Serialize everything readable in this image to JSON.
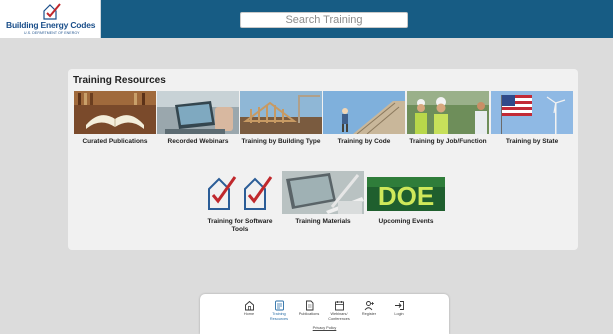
{
  "header": {
    "logo_title": "Building Energy Codes",
    "logo_subtitle": "U.S. DEPARTMENT OF ENERGY",
    "search_placeholder": "Search Training"
  },
  "resources": {
    "title": "Training Resources",
    "tiles": [
      {
        "label": "Curated Publications",
        "image": "open-book-icon"
      },
      {
        "label": "Recorded Webinars",
        "image": "laptop-icon"
      },
      {
        "label": "Training by Building Type",
        "image": "building-frame-icon"
      },
      {
        "label": "Training by Code",
        "image": "construction-worker-icon"
      },
      {
        "label": "Training by Job/Function",
        "image": "hard-hat-workers-icon"
      },
      {
        "label": "Training by State",
        "image": "us-flag-icon"
      },
      {
        "label": "Training for Software Tools",
        "image": "software-tools-logo-icon"
      },
      {
        "label": "Training Materials",
        "image": "notebook-pen-icon"
      },
      {
        "label": "Upcoming Events",
        "image": "doe-logo-icon"
      }
    ],
    "doe_logo_text": "DOE"
  },
  "bottom_nav": {
    "items": [
      {
        "label": "Home",
        "icon": "home-icon"
      },
      {
        "label": "Training Resources",
        "icon": "training-resources-icon",
        "active": true
      },
      {
        "label": "Publications",
        "icon": "document-icon"
      },
      {
        "label": "Webinars/ Conferences",
        "icon": "calendar-icon"
      },
      {
        "label": "Register",
        "icon": "add-user-icon"
      },
      {
        "label": "Login",
        "icon": "login-icon"
      }
    ],
    "privacy_label": "Privacy Policy"
  },
  "colors": {
    "header_bg": "#175c84",
    "page_bg": "#dcdcdc",
    "card_bg": "#f1f1f1",
    "accent": "#2a6ea6",
    "logo_red": "#c0282c"
  }
}
